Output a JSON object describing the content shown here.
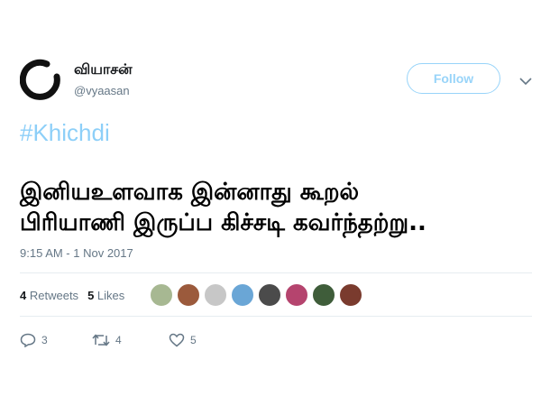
{
  "user": {
    "display_name": "வியாசன்",
    "handle": "@vyaasan"
  },
  "follow_label": "Follow",
  "tweet": {
    "hashtag": "#Khichdi",
    "text_line1": "இனியஉளவாக இன்னாது கூறல்",
    "text_line2": "பிரியாணி இருப்ப கிச்சடி கவர்ந்தற்று..",
    "timestamp": "9:15 AM - 1 Nov 2017"
  },
  "stats": {
    "retweets_count": "4",
    "retweets_label": "Retweets",
    "likes_count": "5",
    "likes_label": "Likes"
  },
  "liker_avatars": [
    "#a7b892",
    "#9b5a3c",
    "#c7c7c7",
    "#6aa6d6",
    "#4b4b4b",
    "#b5446e",
    "#3f5d3a",
    "#7a3b2e"
  ],
  "actions": {
    "replies": "3",
    "retweets": "4",
    "likes": "5"
  },
  "colors": {
    "accent": "#1da1f2",
    "muted": "#657786"
  }
}
